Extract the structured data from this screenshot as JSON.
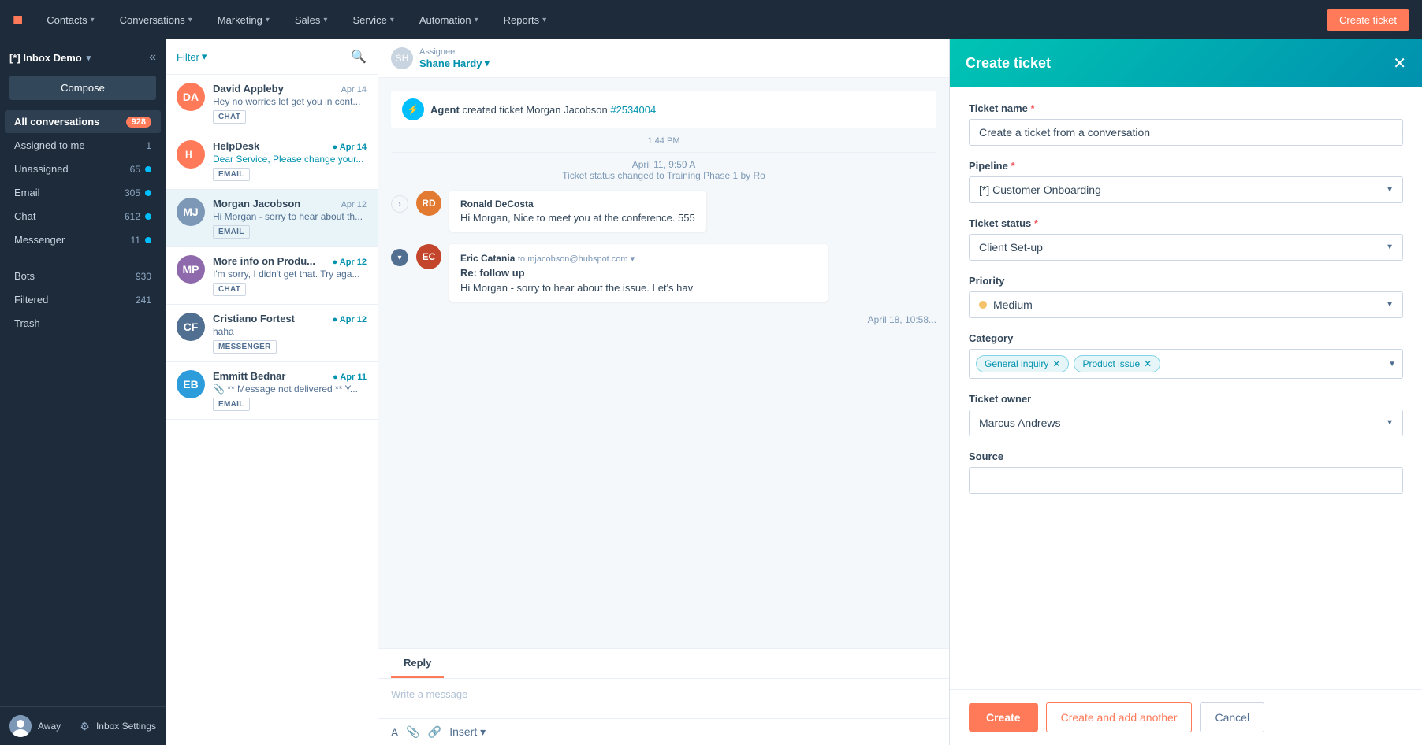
{
  "topNav": {
    "logo": "H",
    "items": [
      {
        "label": "Contacts",
        "id": "contacts"
      },
      {
        "label": "Conversations",
        "id": "conversations"
      },
      {
        "label": "Marketing",
        "id": "marketing"
      },
      {
        "label": "Sales",
        "id": "sales"
      },
      {
        "label": "Service",
        "id": "service"
      },
      {
        "label": "Automation",
        "id": "automation"
      },
      {
        "label": "Reports",
        "id": "reports"
      }
    ],
    "createTicketLabel": "Create ticket"
  },
  "sidebar": {
    "inboxTitle": "[*] Inbox Demo",
    "composeLabel": "Compose",
    "navItems": [
      {
        "label": "All conversations",
        "count": "928",
        "hasDot": true,
        "active": true
      },
      {
        "label": "Assigned to me",
        "count": "1",
        "hasDot": false
      },
      {
        "label": "Unassigned",
        "count": "65",
        "hasDot": true
      },
      {
        "label": "Email",
        "count": "305",
        "hasDot": true
      },
      {
        "label": "Chat",
        "count": "612",
        "hasDot": true
      },
      {
        "label": "Messenger",
        "count": "11",
        "hasDot": true
      },
      {
        "label": "Bots",
        "count": "930",
        "hasDot": false
      },
      {
        "label": "Filtered",
        "count": "241",
        "hasDot": false
      },
      {
        "label": "Trash",
        "count": "",
        "hasDot": false
      }
    ],
    "statusLabel": "Away",
    "settingsLabel": "Inbox Settings"
  },
  "convList": {
    "filterLabel": "Filter",
    "items": [
      {
        "name": "David Appleby",
        "date": "Apr 14",
        "dateNew": false,
        "preview": "Hey no worries let get you in cont...",
        "tag": "CHAT",
        "avatarInitials": "DA",
        "avatarColor": "avatar-orange"
      },
      {
        "name": "HelpDesk",
        "date": "Apr 14",
        "dateNew": true,
        "preview": "Dear Service, Please change your...",
        "tag": "EMAIL",
        "avatarInitials": "H",
        "avatarColor": "avatar-hubspot"
      },
      {
        "name": "Morgan Jacobson",
        "date": "Apr 12",
        "dateNew": false,
        "preview": "Hi Morgan - sorry to hear about th...",
        "tag": "EMAIL",
        "avatarInitials": "MJ",
        "avatarColor": "avatar-morgan",
        "active": true
      },
      {
        "name": "More info on Produ...",
        "date": "Apr 12",
        "dateNew": true,
        "preview": "I'm sorry, I didn't get that. Try aga...",
        "tag": "CHAT",
        "avatarInitials": "MP",
        "avatarColor": "avatar-mp"
      },
      {
        "name": "Cristiano Fortest",
        "date": "Apr 12",
        "dateNew": true,
        "preview": "haha",
        "tag": "MESSENGER",
        "avatarInitials": "CF",
        "avatarColor": "avatar-cf"
      },
      {
        "name": "Emmitt Bednar",
        "date": "Apr 11",
        "dateNew": true,
        "preview": "** Message not delivered ** Y...",
        "tag": "EMAIL",
        "avatarInitials": "EB",
        "avatarColor": "avatar-eb",
        "hasAttachment": true
      }
    ]
  },
  "conversation": {
    "assigneeLabel": "Assignee",
    "assigneeName": "Shane Hardy",
    "messages": [
      {
        "type": "agent-event",
        "text": "Agent created ticket Morgan Jacobson",
        "ticketNum": "#2534004",
        "time": "1:44 PM"
      },
      {
        "type": "status-change",
        "text": "Ticket status changed to Training Phase 1 by Ro",
        "time": "April 11, 9:59 A"
      },
      {
        "type": "message",
        "sender": "Ronald DeCosta",
        "preview": "Hi Morgan, Nice to meet you at the conference. 555",
        "avatarInitials": "RD",
        "avatarColor": "avatar-rd"
      },
      {
        "type": "message",
        "sender": "Eric Catania",
        "to": "to mjacobson@hubspot.com",
        "subject": "Re: follow up",
        "preview": "Hi Morgan - sorry to hear about the issue. Let's hav",
        "avatarInitials": "EC",
        "avatarColor": "avatar-ec",
        "time": "April 18, 10:58",
        "expanded": true
      }
    ],
    "replyTab": "Reply",
    "replyPlaceholder": "Write a message",
    "insertLabel": "Insert"
  },
  "createTicket": {
    "title": "Create ticket",
    "fields": {
      "ticketNameLabel": "Ticket name",
      "ticketNameValue": "Create a ticket from a conversation",
      "pipelineLabel": "Pipeline",
      "pipelineValue": "[*] Customer Onboarding",
      "ticketStatusLabel": "Ticket status",
      "ticketStatusValue": "Client Set-up",
      "priorityLabel": "Priority",
      "priorityValue": "Medium",
      "categoryLabel": "Category",
      "categoryTags": [
        "General inquiry",
        "Product issue"
      ],
      "ticketOwnerLabel": "Ticket owner",
      "ticketOwnerValue": "Marcus Andrews",
      "sourceLabel": "Source",
      "sourcePlaceholder": ""
    },
    "buttons": {
      "createLabel": "Create",
      "createAddLabel": "Create and add another",
      "cancelLabel": "Cancel"
    }
  }
}
